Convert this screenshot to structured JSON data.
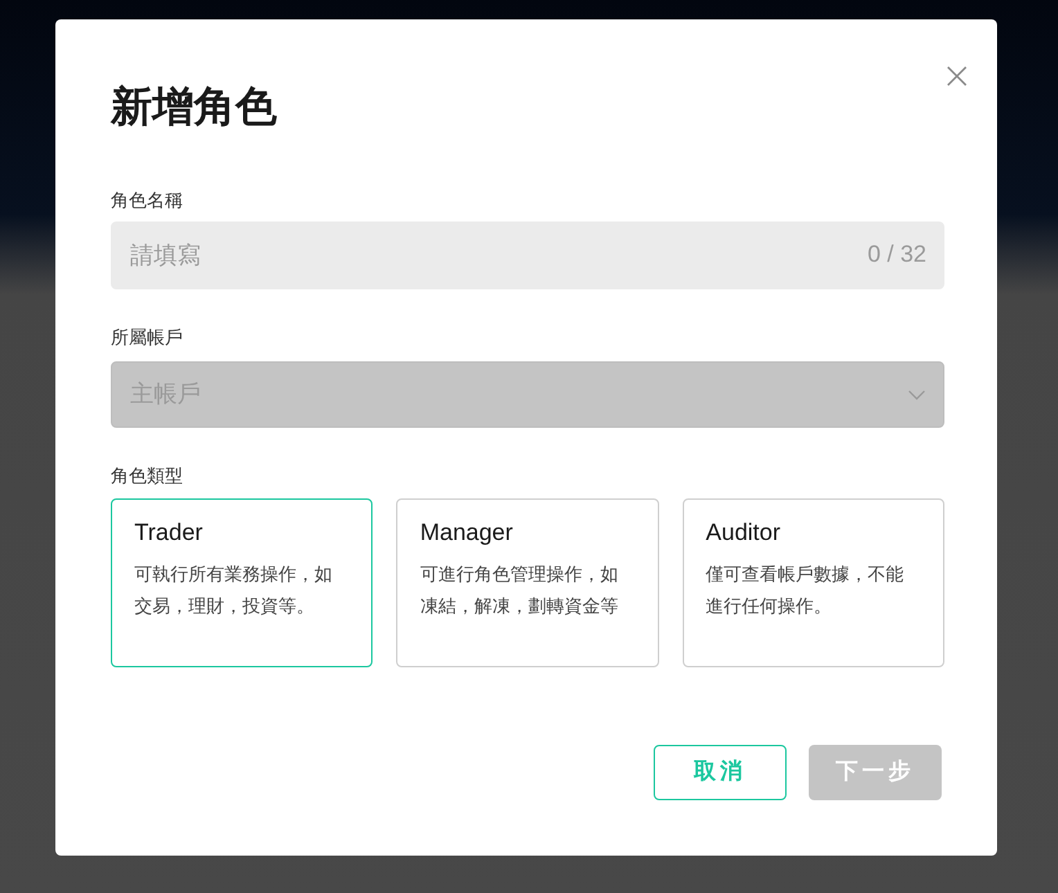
{
  "dialog": {
    "title": "新增角色"
  },
  "fields": [
    {
      "kind": "text",
      "label": "角色名稱",
      "placeholder": "請填寫",
      "counter": "0 / 32",
      "disabled": false
    },
    {
      "kind": "select",
      "label": "所屬帳戶",
      "value": "主帳戶",
      "disabled": true
    }
  ],
  "role_type": {
    "label": "角色類型",
    "options": [
      {
        "title": "Trader",
        "description": "可執行所有業務操作，如交易，理財，投資等。",
        "selected": true
      },
      {
        "title": "Manager",
        "description": "可進行角色管理操作，如凍結，解凍，劃轉資金等",
        "selected": false
      },
      {
        "title": "Auditor",
        "description": "僅可查看帳戶數據，不能進行任何操作。",
        "selected": false
      }
    ]
  },
  "buttons": [
    {
      "label": "取消",
      "kind": "secondary",
      "disabled": false
    },
    {
      "label": "下一步",
      "kind": "primary",
      "disabled": true
    }
  ]
}
